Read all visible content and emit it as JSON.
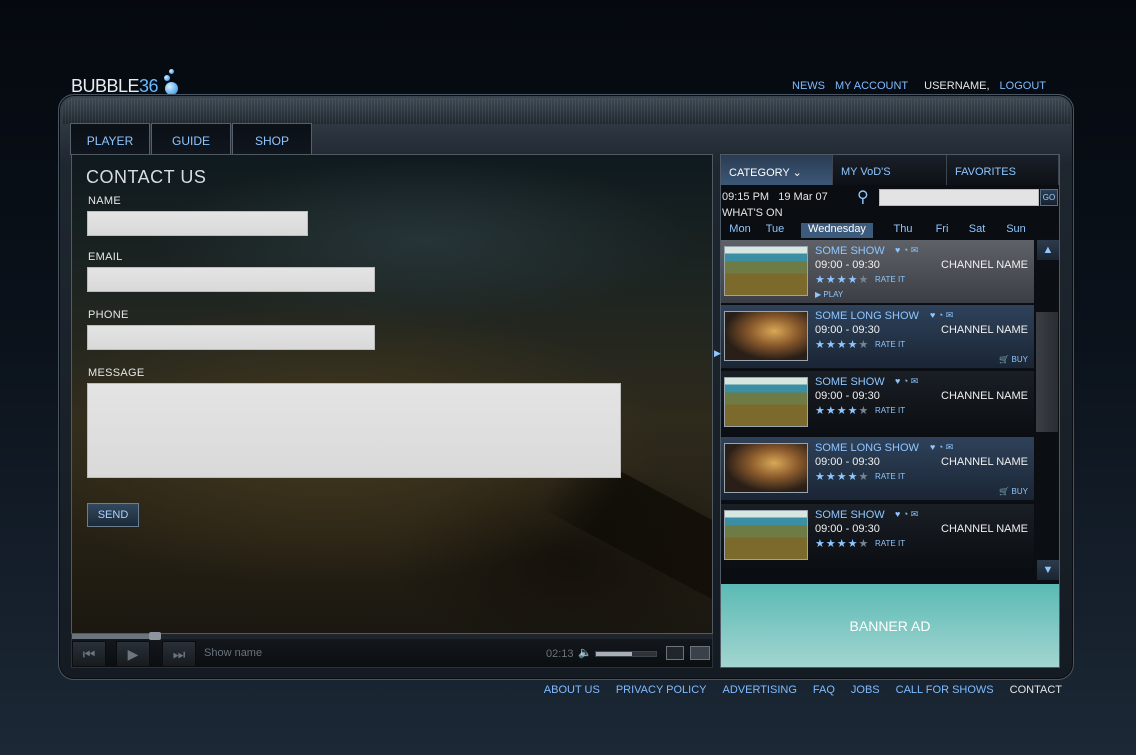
{
  "brand": {
    "logo_text": "BUBBLE",
    "logo_num": "36"
  },
  "topnav": {
    "news": "NEWS",
    "account": "MY ACCOUNT",
    "username": "USERNAME,",
    "logout": "LOGOUT"
  },
  "tabs": [
    "PLAYER",
    "GUIDE",
    "SHOP"
  ],
  "form": {
    "title": "CONTACT US",
    "name_label": "NAME",
    "email_label": "EMAIL",
    "phone_label": "PHONE",
    "message_label": "MESSAGE",
    "send_label": "SEND"
  },
  "player": {
    "show_name": "Show name",
    "time": "02:13",
    "progress": 0.13,
    "volume": 0.6
  },
  "guide": {
    "tabs": [
      "CATEGORY ⌄",
      "MY VoD'S",
      "FAVORITES"
    ],
    "time": "09:15 PM",
    "date": "19 Mar 07",
    "whats_on": "WHAT'S ON",
    "go": "GO",
    "days": [
      "Mon",
      "Tue",
      "Wednesday",
      "Thu",
      "Fri",
      "Sat",
      "Sun"
    ],
    "selected_day": "Wednesday",
    "listings": [
      {
        "title": "SOME SHOW",
        "time": "09:00 - 09:30",
        "channel": "CHANNEL NAME",
        "rate": "RATE IT",
        "action": "PLAY",
        "rating": 4
      },
      {
        "title": "SOME LONG SHOW",
        "time": "09:00 - 09:30",
        "channel": "CHANNEL NAME",
        "rate": "RATE IT",
        "action": "BUY",
        "rating": 4
      },
      {
        "title": "SOME SHOW",
        "time": "09:00 - 09:30",
        "channel": "CHANNEL NAME",
        "rate": "RATE IT",
        "action": "",
        "rating": 4
      },
      {
        "title": "SOME LONG SHOW",
        "time": "09:00 - 09:30",
        "channel": "CHANNEL NAME",
        "rate": "RATE IT",
        "action": "BUY",
        "rating": 4
      },
      {
        "title": "SOME SHOW",
        "time": "09:00 - 09:30",
        "channel": "CHANNEL NAME",
        "rate": "RATE IT",
        "action": "",
        "rating": 4
      }
    ],
    "banner": "BANNER AD"
  },
  "footer": [
    "ABOUT US",
    "PRIVACY POLICY",
    "ADVERTISING",
    "FAQ",
    "JOBS",
    "CALL FOR SHOWS",
    "CONTACT"
  ],
  "colors": {
    "accent": "#8ec6ff",
    "banner": "#5bbab5",
    "selected_day": "#3c5a7c"
  }
}
